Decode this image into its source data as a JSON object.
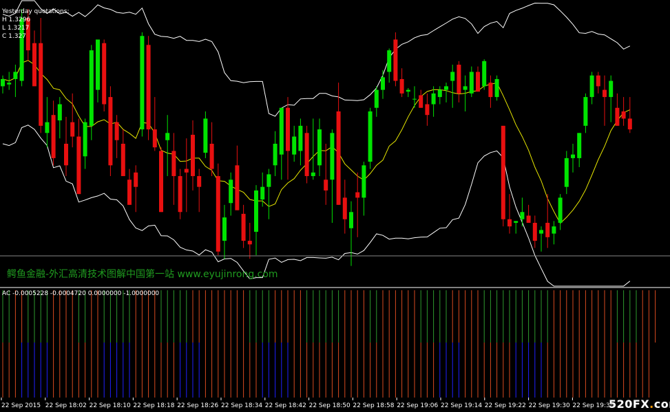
{
  "quotations": {
    "title": "Yesterday quotations:",
    "high": "H 1.3296",
    "low": "L 1.3217",
    "close": "C 1.327"
  },
  "watermark": "鳄鱼金融-外汇高清技术图解中国第一站 www.eyujinrong.com",
  "indicator_label": "AC -0.0005228 -0.0004720 0.0000000 -1.0000000",
  "logo": {
    "main": "520FX",
    "dot": ".",
    "suffix": "com"
  },
  "colors": {
    "bull": "#00e400",
    "bear": "#e81010",
    "bands": "#ffffff",
    "ma": "#e6e600",
    "grid_separator": "#ffffff",
    "watermark": "#1f9a1f",
    "ac_up": "#2e9a2e",
    "ac_down": "#d84a20",
    "ac_blue": "#2020ff"
  },
  "chart_data": {
    "type": "candlestick",
    "price_range": [
      1.315,
      1.331
    ],
    "x_labels": [
      "22 Sep 2015",
      "22 Sep 18:02",
      "22 Sep 18:10",
      "22 Sep 18:18",
      "22 Sep 18:26",
      "22 Sep 18:34",
      "22 Sep 18:42",
      "22 Sep 18:50",
      "22 Sep 18:58",
      "22 Sep 19:06",
      "22 Sep 19:14",
      "22 Sep 19:22",
      "22 Sep 19:30",
      "22 Sep 19:38"
    ],
    "candles": [
      [
        1.3262,
        1.3268,
        1.3258,
        1.3266
      ],
      [
        1.3263,
        1.327,
        1.326,
        1.3264
      ],
      [
        1.3266,
        1.3274,
        1.3256,
        1.327
      ],
      [
        1.3265,
        1.3305,
        1.3262,
        1.33
      ],
      [
        1.33,
        1.3305,
        1.3276,
        1.3282
      ],
      [
        1.3286,
        1.3293,
        1.3262,
        1.3262
      ],
      [
        1.3286,
        1.33,
        1.3236,
        1.324
      ],
      [
        1.3236,
        1.3256,
        1.3228,
        1.3242
      ],
      [
        1.3246,
        1.3254,
        1.3218,
        1.3222
      ],
      [
        1.3243,
        1.3256,
        1.3233,
        1.3252
      ],
      [
        1.323,
        1.3245,
        1.3212,
        1.3218
      ],
      [
        1.3242,
        1.3258,
        1.3228,
        1.3234
      ],
      [
        1.3234,
        1.3244,
        1.3202,
        1.3202
      ],
      [
        1.3223,
        1.3244,
        1.3216,
        1.3242
      ],
      [
        1.324,
        1.3285,
        1.3232,
        1.3282
      ],
      [
        1.326,
        1.3288,
        1.3253,
        1.3288
      ],
      [
        1.3286,
        1.3288,
        1.3248,
        1.3252
      ],
      [
        1.3256,
        1.3262,
        1.3212,
        1.3218
      ],
      [
        1.3242,
        1.3246,
        1.3222,
        1.3232
      ],
      [
        1.323,
        1.3238,
        1.3212,
        1.3212
      ],
      [
        1.321,
        1.3216,
        1.3196,
        1.3196
      ],
      [
        1.3214,
        1.3218,
        1.3192,
        1.3206
      ],
      [
        1.3238,
        1.3292,
        1.3234,
        1.329
      ],
      [
        1.3285,
        1.329,
        1.3232,
        1.3238
      ],
      [
        1.3238,
        1.3256,
        1.3226,
        1.3228
      ],
      [
        1.3226,
        1.3228,
        1.3192,
        1.3192
      ],
      [
        1.3232,
        1.3246,
        1.3212,
        1.3236
      ],
      [
        1.3226,
        1.3236,
        1.3196,
        1.3212
      ],
      [
        1.3212,
        1.3216,
        1.3188,
        1.3192
      ],
      [
        1.3216,
        1.3233,
        1.3192,
        1.3214
      ],
      [
        1.3235,
        1.3243,
        1.3204,
        1.3212
      ],
      [
        1.3212,
        1.3216,
        1.3192,
        1.3206
      ],
      [
        1.3225,
        1.3248,
        1.3222,
        1.3244
      ],
      [
        1.323,
        1.3242,
        1.3212,
        1.3216
      ],
      [
        1.3212,
        1.3219,
        1.3168,
        1.317
      ],
      [
        1.3176,
        1.3196,
        1.3166,
        1.3189
      ],
      [
        1.3197,
        1.3214,
        1.319,
        1.321
      ],
      [
        1.3218,
        1.3229,
        1.3193,
        1.3193
      ],
      [
        1.3191,
        1.3196,
        1.3172,
        1.3176
      ],
      [
        1.3176,
        1.3186,
        1.3166,
        1.3174
      ],
      [
        1.3181,
        1.3207,
        1.3168,
        1.3204
      ],
      [
        1.3199,
        1.3214,
        1.3195,
        1.3206
      ],
      [
        1.3206,
        1.3216,
        1.3188,
        1.3213
      ],
      [
        1.3218,
        1.3237,
        1.3212,
        1.323
      ],
      [
        1.3224,
        1.325,
        1.321,
        1.325
      ],
      [
        1.325,
        1.3256,
        1.321,
        1.3226
      ],
      [
        1.3224,
        1.324,
        1.322,
        1.3234
      ],
      [
        1.3226,
        1.3244,
        1.3218,
        1.324
      ],
      [
        1.3236,
        1.324,
        1.3208,
        1.3212
      ],
      [
        1.3212,
        1.3244,
        1.321,
        1.3214
      ],
      [
        1.3218,
        1.3244,
        1.3212,
        1.3238
      ],
      [
        1.321,
        1.323,
        1.3196,
        1.3204
      ],
      [
        1.321,
        1.3238,
        1.3186,
        1.3236
      ],
      [
        1.3248,
        1.3264,
        1.3196,
        1.3196
      ],
      [
        1.32,
        1.321,
        1.318,
        1.3188
      ],
      [
        1.3183,
        1.3198,
        1.3162,
        1.3192
      ],
      [
        1.3203,
        1.3214,
        1.3178,
        1.32
      ],
      [
        1.32,
        1.322,
        1.319,
        1.3218
      ],
      [
        1.322,
        1.325,
        1.3216,
        1.3248
      ],
      [
        1.325,
        1.3262,
        1.3245,
        1.326
      ],
      [
        1.326,
        1.3271,
        1.3255,
        1.3267
      ],
      [
        1.327,
        1.3283,
        1.3264,
        1.3282
      ],
      [
        1.3288,
        1.3292,
        1.3262,
        1.3265
      ],
      [
        1.3266,
        1.3272,
        1.3256,
        1.3258
      ],
      [
        1.3259,
        1.3261,
        1.3256,
        1.326
      ],
      [
        1.3255,
        1.3262,
        1.325,
        1.3255
      ],
      [
        1.3257,
        1.326,
        1.325,
        1.325
      ],
      [
        1.3252,
        1.3258,
        1.324,
        1.3246
      ],
      [
        1.3252,
        1.3262,
        1.3245,
        1.3258
      ],
      [
        1.3256,
        1.3262,
        1.3252,
        1.326
      ],
      [
        1.326,
        1.3264,
        1.3253,
        1.3262
      ],
      [
        1.3265,
        1.3274,
        1.325,
        1.327
      ],
      [
        1.3274,
        1.3276,
        1.3253,
        1.3258
      ],
      [
        1.326,
        1.3268,
        1.3248,
        1.3262
      ],
      [
        1.3258,
        1.3273,
        1.3256,
        1.327
      ],
      [
        1.327,
        1.3273,
        1.3259,
        1.3259
      ],
      [
        1.3262,
        1.3277,
        1.326,
        1.3276
      ],
      [
        1.3264,
        1.3268,
        1.325,
        1.3256
      ],
      [
        1.3256,
        1.3268,
        1.3254,
        1.3266
      ],
      [
        1.324,
        1.324,
        1.3184,
        1.3188
      ],
      [
        1.3188,
        1.3202,
        1.318,
        1.3184
      ],
      [
        1.3186,
        1.3187,
        1.318,
        1.3187
      ],
      [
        1.3188,
        1.32,
        1.3184,
        1.3192
      ],
      [
        1.319,
        1.3196,
        1.3186,
        1.3186
      ],
      [
        1.3186,
        1.319,
        1.3172,
        1.3176
      ],
      [
        1.318,
        1.3184,
        1.317,
        1.3182
      ],
      [
        1.3186,
        1.3202,
        1.3172,
        1.3178
      ],
      [
        1.318,
        1.3187,
        1.3174,
        1.3184
      ],
      [
        1.3186,
        1.3202,
        1.3182,
        1.32
      ],
      [
        1.3206,
        1.3226,
        1.3202,
        1.3222
      ],
      [
        1.3222,
        1.323,
        1.3214,
        1.3224
      ],
      [
        1.3222,
        1.3236,
        1.3217,
        1.3236
      ],
      [
        1.324,
        1.3258,
        1.3236,
        1.3256
      ],
      [
        1.3256,
        1.327,
        1.3252,
        1.3268
      ],
      [
        1.3268,
        1.327,
        1.3258,
        1.3262
      ],
      [
        1.326,
        1.3268,
        1.324,
        1.3256
      ],
      [
        1.3256,
        1.3268,
        1.3242,
        1.3265
      ],
      [
        1.325,
        1.3258,
        1.324,
        1.324
      ],
      [
        1.3248,
        1.3256,
        1.324,
        1.3244
      ],
      [
        1.3244,
        1.3256,
        1.3236,
        1.3238
      ]
    ],
    "ac_pattern_top": "GGRRGGGGRRRRGGRRGGGGGRRRRGGGGGRRRRRRRRRGGGGRRRRRGGGGGGRRRRGGRRRRRRGGGGGRRRRRGGGGGGGGGGGRRRRRRRRRRGGGGRRR",
    "ac_pattern_bottom": "RRRBBBBBRRRRRRRRBBBBBRRRRRRRBBBBRRRRRRRRRBBBBBRRRRRRRRRRRRRRRRRRRRRRRBBBBRRRRRRRRBBBBBRRRRRRRRRRRRRRRRR"
  }
}
